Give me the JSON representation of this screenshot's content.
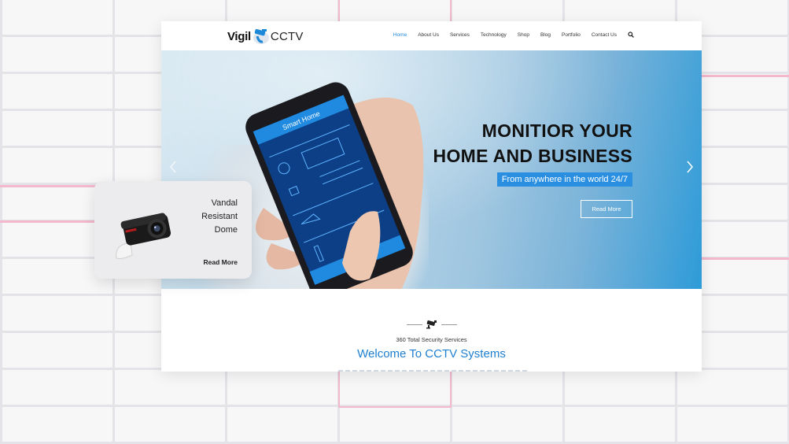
{
  "brand": {
    "name_part1": "Vigil",
    "name_part2": "CCTV"
  },
  "nav": {
    "items": [
      {
        "label": "Home",
        "active": true
      },
      {
        "label": "About Us"
      },
      {
        "label": "Services"
      },
      {
        "label": "Technology"
      },
      {
        "label": "Shop"
      },
      {
        "label": "Blog"
      },
      {
        "label": "Portfolio"
      },
      {
        "label": "Contact Us"
      }
    ],
    "search_icon": "search-icon"
  },
  "hero": {
    "title_line1": "MONITIOR YOUR",
    "title_line2": "HOME AND BUSINESS",
    "subtitle": "From anywhere in the world 24/7",
    "button": "Read More",
    "phone_screen_title": "Smart Home"
  },
  "section": {
    "tagline": "360 Total Security Services",
    "heading": "Welcome To CCTV Systems"
  },
  "card": {
    "title_line1": "Vandal",
    "title_line2": "Resistant",
    "title_line3": "Dome",
    "link": "Read More"
  },
  "colors": {
    "accent": "#1e88d8",
    "subtitle_bg": "#2a8fe0",
    "background_accent": "#f2b8cc"
  }
}
